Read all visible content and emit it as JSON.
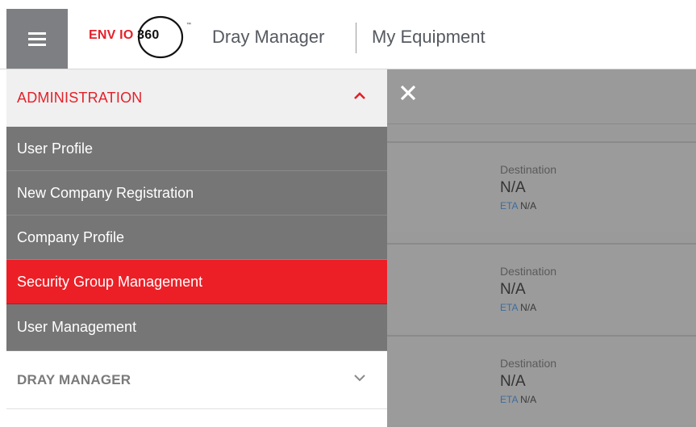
{
  "header": {
    "logo_text_prefix": "ENV",
    "logo_text_suffix": "O",
    "logo_number": "360",
    "title": "Dray Manager",
    "subtitle": "My Equipment"
  },
  "sidebar": {
    "admin_section": {
      "label": "ADMINISTRATION",
      "expanded": true,
      "items": [
        {
          "label": "User Profile",
          "active": false
        },
        {
          "label": "New Company Registration",
          "active": false
        },
        {
          "label": "Company Profile",
          "active": false
        },
        {
          "label": "Security Group Management",
          "active": true
        },
        {
          "label": "User Management",
          "active": false
        }
      ]
    },
    "dray_section": {
      "label": "DRAY MANAGER",
      "expanded": false
    }
  },
  "panel": {
    "cards": [
      {
        "destination_label": "Destination",
        "destination_value": "N/A",
        "eta_label": "ETA",
        "eta_value": "N/A"
      },
      {
        "destination_label": "Destination",
        "destination_value": "N/A",
        "eta_label": "ETA",
        "eta_value": "N/A"
      },
      {
        "destination_label": "Destination",
        "destination_value": "N/A",
        "eta_label": "ETA",
        "eta_value": "N/A"
      }
    ]
  },
  "colors": {
    "brand_red": "#e4212a",
    "menu_gray": "#767676",
    "active_red": "#ec1f27",
    "overlay_gray": "#9a9a9a"
  },
  "icons": {
    "menu": "hamburger-icon",
    "close": "close-icon",
    "expanded": "chevron-up-icon",
    "collapsed": "chevron-down-icon"
  }
}
